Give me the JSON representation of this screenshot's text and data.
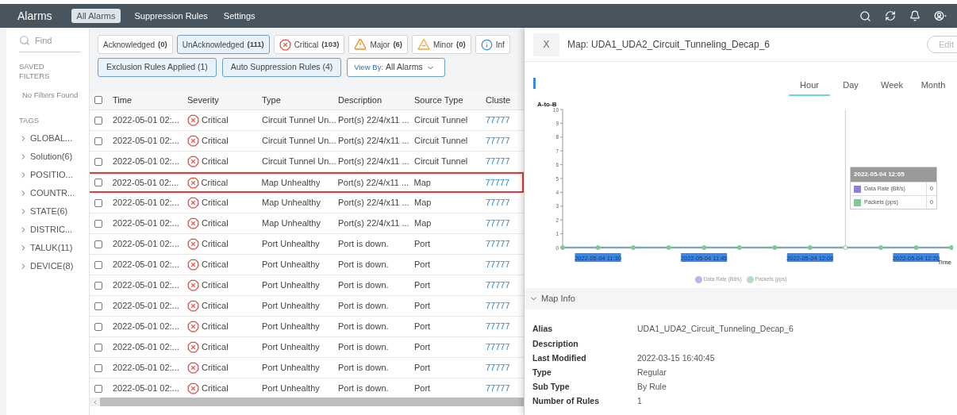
{
  "topbar": {
    "title": "Alarms",
    "tabs": [
      {
        "label": "All Alarms",
        "selected": true
      },
      {
        "label": "Suppression Rules",
        "selected": false
      },
      {
        "label": "Settings",
        "selected": false
      }
    ]
  },
  "sidebar": {
    "search": {
      "placeholder": "Find"
    },
    "saved_heading": "SAVED FILTERS",
    "saved_empty": "No Filters Found",
    "tags_heading": "TAGS",
    "tags": [
      "GLOBAL...",
      "Solution(6)",
      "POSITIO...",
      "COUNTR...",
      "STATE(6)",
      "DISTRIC...",
      "TALUK(11)",
      "DEVICE(8)"
    ]
  },
  "filters": [
    {
      "kind": "plain",
      "label": "Acknowledged",
      "count": "(0)",
      "active": false
    },
    {
      "kind": "plain",
      "label": "UnAcknowledged",
      "count": "(111)",
      "active": true
    },
    {
      "kind": "critical",
      "label": "Critical",
      "count": "(103)",
      "active": false
    },
    {
      "kind": "major",
      "label": "Major",
      "count": "(6)",
      "active": false
    },
    {
      "kind": "minor",
      "label": "Minor",
      "count": "(0)",
      "active": false
    },
    {
      "kind": "info",
      "label": "Inf",
      "active": false
    }
  ],
  "rule_filters": [
    {
      "label": "Exclusion Rules Applied (1)",
      "active": true
    },
    {
      "label": "Auto Suppression Rules (4)",
      "active": true
    }
  ],
  "view_by": {
    "label": "View By:",
    "value": "All Alarms"
  },
  "table": {
    "all_checked": false,
    "columns": [
      "Time",
      "Severity",
      "Type",
      "Description",
      "Source Type",
      "Cluste"
    ],
    "rows": [
      {
        "checked": false,
        "selected": false,
        "time": "2022-05-01 02:...",
        "severity": {
          "kind": "critical",
          "label": "Critical"
        },
        "type": "Circuit Tunnel Un...",
        "description": "Port(s) 22/4/x11 ...",
        "source_type": "Circuit Tunnel",
        "cluster": "77777"
      },
      {
        "checked": false,
        "selected": false,
        "time": "2022-05-01 02:...",
        "severity": {
          "kind": "critical",
          "label": "Critical"
        },
        "type": "Circuit Tunnel Un...",
        "description": "Port(s) 22/4/x11 ...",
        "source_type": "Circuit Tunnel",
        "cluster": "77777"
      },
      {
        "checked": false,
        "selected": false,
        "time": "2022-05-01 02:...",
        "severity": {
          "kind": "critical",
          "label": "Critical"
        },
        "type": "Circuit Tunnel Un...",
        "description": "Port(s) 22/4/x11 ...",
        "source_type": "Circuit Tunnel",
        "cluster": "77777"
      },
      {
        "checked": false,
        "selected": true,
        "time": "2022-05-01 02:...",
        "severity": {
          "kind": "critical",
          "label": "Critical"
        },
        "type": "Map Unhealthy",
        "description": "Port(s) 22/4/x11 ...",
        "source_type": "Map",
        "cluster": "77777"
      },
      {
        "checked": false,
        "selected": false,
        "time": "2022-05-01 02:...",
        "severity": {
          "kind": "critical",
          "label": "Critical"
        },
        "type": "Map Unhealthy",
        "description": "Port(s) 22/4/x11 ...",
        "source_type": "Map",
        "cluster": "77777"
      },
      {
        "checked": false,
        "selected": false,
        "time": "2022-05-01 02:...",
        "severity": {
          "kind": "critical",
          "label": "Critical"
        },
        "type": "Map Unhealthy",
        "description": "Port(s) 22/4/x11 ...",
        "source_type": "Map",
        "cluster": "77777"
      },
      {
        "checked": false,
        "selected": false,
        "time": "2022-05-01 02:...",
        "severity": {
          "kind": "critical",
          "label": "Critical"
        },
        "type": "Port Unhealthy",
        "description": "Port is down.",
        "source_type": "Port",
        "cluster": "77777"
      },
      {
        "checked": false,
        "selected": false,
        "time": "2022-05-01 02:...",
        "severity": {
          "kind": "critical",
          "label": "Critical"
        },
        "type": "Port Unhealthy",
        "description": "Port is down.",
        "source_type": "Port",
        "cluster": "77777"
      },
      {
        "checked": false,
        "selected": false,
        "time": "2022-05-01 02:...",
        "severity": {
          "kind": "critical",
          "label": "Critical"
        },
        "type": "Port Unhealthy",
        "description": "Port is down.",
        "source_type": "Port",
        "cluster": "77777"
      },
      {
        "checked": false,
        "selected": false,
        "time": "2022-05-01 02:...",
        "severity": {
          "kind": "critical",
          "label": "Critical"
        },
        "type": "Port Unhealthy",
        "description": "Port is down.",
        "source_type": "Port",
        "cluster": "77777"
      },
      {
        "checked": false,
        "selected": false,
        "time": "2022-05-01 02:...",
        "severity": {
          "kind": "critical",
          "label": "Critical"
        },
        "type": "Port Unhealthy",
        "description": "Port is down.",
        "source_type": "Port",
        "cluster": "77777"
      },
      {
        "checked": false,
        "selected": false,
        "time": "2022-05-01 02:...",
        "severity": {
          "kind": "critical",
          "label": "Critical"
        },
        "type": "Port Unhealthy",
        "description": "Port is down.",
        "source_type": "Port",
        "cluster": "77777"
      },
      {
        "checked": false,
        "selected": false,
        "time": "2022-05-01 02:...",
        "severity": {
          "kind": "critical",
          "label": "Critical"
        },
        "type": "Port Unhealthy",
        "description": "Port is down.",
        "source_type": "Port",
        "cluster": "77777"
      },
      {
        "checked": false,
        "selected": false,
        "time": "2022-05-01 02:...",
        "severity": {
          "kind": "critical",
          "label": "Critical"
        },
        "type": "Port Unhealthy",
        "description": "Port is down.",
        "source_type": "Port",
        "cluster": "77777"
      }
    ]
  },
  "panel": {
    "close": "X",
    "title": "Map: UDA1_UDA2_Circuit_Tunneling_Decap_6",
    "edit": "Edit",
    "ranges": [
      {
        "label": "Hour",
        "selected": true
      },
      {
        "label": "Day",
        "selected": false
      },
      {
        "label": "Week",
        "selected": false
      },
      {
        "label": "Month",
        "selected": false
      }
    ],
    "chart_data": {
      "type": "line",
      "ylabel": "A-to-B",
      "xlabel": "Time",
      "categories": [
        null,
        "2022-05-04 11:30",
        null,
        null,
        "2022-05-04 11:45",
        null,
        null,
        "2022-05-04 12:00",
        null,
        null,
        "2022-05-04 12:20",
        null
      ],
      "ylim": [
        0,
        10
      ],
      "yticks": [
        0,
        1,
        2,
        3,
        4,
        5,
        6,
        7,
        8,
        9,
        10
      ],
      "series": [
        {
          "name": "Data Rate (Bit/s)",
          "color": "#8a84d6",
          "values": [
            0,
            0,
            0,
            0,
            0,
            0,
            0,
            0,
            0,
            0,
            0,
            0
          ]
        },
        {
          "name": "Packets (pps)",
          "color": "#7fc89a",
          "marker": "circle",
          "values": [
            0,
            0,
            0,
            0,
            0,
            0,
            0,
            0,
            0,
            0,
            0,
            0
          ]
        }
      ],
      "legend": "bottom"
    },
    "tooltip_title": "2022-05-04 12:05",
    "tooltip_rows": [
      {
        "label": "Data Rate (Bit/s)",
        "value": "0",
        "color": "#8a84d6"
      },
      {
        "label": "Packets (pps)",
        "value": "0",
        "color": "#7fc89a"
      }
    ],
    "map_info": {
      "heading": "Map Info",
      "expanded": true,
      "fields": [
        {
          "label": "Alias",
          "value": "UDA1_UDA2_Circuit_Tunneling_Decap_6"
        },
        {
          "label": "Description"
        },
        {
          "label": "Last Modified",
          "value": "2022-03-15 16:40:45"
        },
        {
          "label": "Type",
          "value": "Regular"
        },
        {
          "label": "Sub Type",
          "value": "By Rule"
        },
        {
          "label": "Number of Rules",
          "value": "1"
        }
      ]
    }
  }
}
